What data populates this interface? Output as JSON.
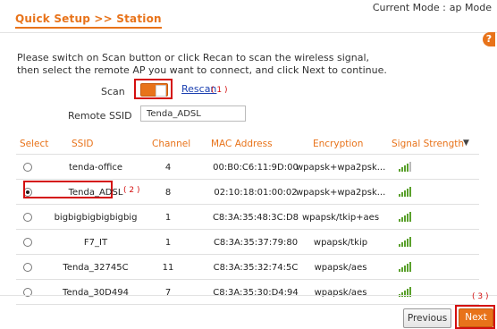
{
  "header": {
    "title": "Quick Setup >> Station",
    "mode_label": "Current Mode :",
    "mode_value": "ap Mode",
    "help": "?"
  },
  "instruction": {
    "line1": "Please switch on Scan button or click Recan to scan the wireless signal,",
    "line2": "then select the remote AP you want to connect, and click Next to continue."
  },
  "scan": {
    "label": "Scan",
    "state": "on",
    "rescan_label": "Rescan",
    "callout": "( 1 )"
  },
  "remote_ssid": {
    "label": "Remote SSID",
    "value": "Tenda_ADSL"
  },
  "table": {
    "headers": {
      "select": "Select",
      "ssid": "SSID",
      "channel": "Channel",
      "mac": "MAC Address",
      "encryption": "Encryption",
      "signal": "Signal Strength"
    },
    "rows": [
      {
        "ssid": "tenda-office",
        "channel": "4",
        "mac": "00:B0:C6:11:9D:00",
        "encryption": "wpapsk+wpa2psk...",
        "signal": 4,
        "selected": false
      },
      {
        "ssid": "Tenda_ADSL",
        "channel": "8",
        "mac": "02:10:18:01:00:02",
        "encryption": "wpapsk+wpa2psk...",
        "signal": 5,
        "selected": true
      },
      {
        "ssid": "bigbigbigbigbigbig",
        "channel": "1",
        "mac": "C8:3A:35:48:3C:D8",
        "encryption": "wpapsk/tkip+aes",
        "signal": 5,
        "selected": false
      },
      {
        "ssid": "F7_IT",
        "channel": "1",
        "mac": "C8:3A:35:37:79:80",
        "encryption": "wpapsk/tkip",
        "signal": 5,
        "selected": false
      },
      {
        "ssid": "Tenda_32745C",
        "channel": "11",
        "mac": "C8:3A:35:32:74:5C",
        "encryption": "wpapsk/aes",
        "signal": 5,
        "selected": false
      },
      {
        "ssid": "Tenda_30D494",
        "channel": "7",
        "mac": "C8:3A:35:30:D4:94",
        "encryption": "wpapsk/aes",
        "signal": 5,
        "selected": false
      }
    ],
    "callout": "( 2 )"
  },
  "footer": {
    "previous_label": "Previous",
    "next_label": "Next",
    "callout": "( 3 )"
  },
  "colors": {
    "accent": "#e8731a",
    "callout_red": "#d40f0f",
    "signal_green": "#5aa02c"
  }
}
